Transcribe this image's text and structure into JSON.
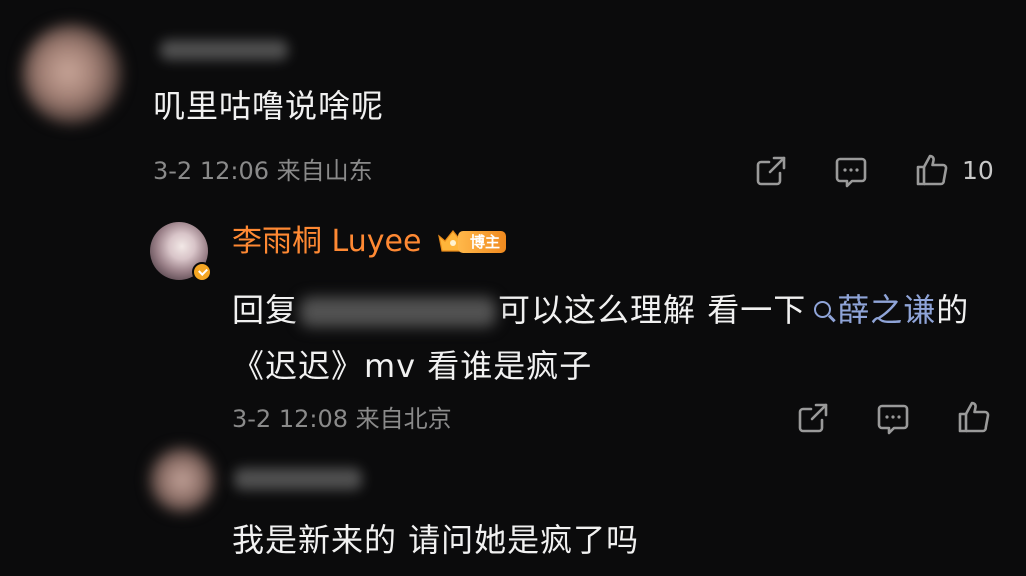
{
  "comments": [
    {
      "username": "",
      "text": "叽里咕噜说啥呢",
      "time": "3-2 12:06",
      "location": "来自山东",
      "likes": "10"
    },
    {
      "username": "李雨桐 Luyee",
      "badge": "博主",
      "reply_prefix": "回复",
      "reply_text_1": "可以这么理解 看一下",
      "search_term": "薛之谦",
      "reply_text_2": "的《迟迟》mv 看谁是疯子",
      "time": "3-2 12:08",
      "location": "来自北京"
    },
    {
      "username": "",
      "text": "我是新来的 请问她是疯了吗"
    }
  ],
  "icons": {
    "share": "share-icon",
    "comment": "comment-icon",
    "like": "thumbs-up-icon",
    "search": "search-icon",
    "crown": "crown-icon",
    "verified": "verified-badge-icon"
  },
  "colors": {
    "background": "#0b0b0c",
    "username_host": "#ff8933",
    "link": "#8fa4d8",
    "meta": "#8a8a8a",
    "badge": "#f5a623"
  }
}
